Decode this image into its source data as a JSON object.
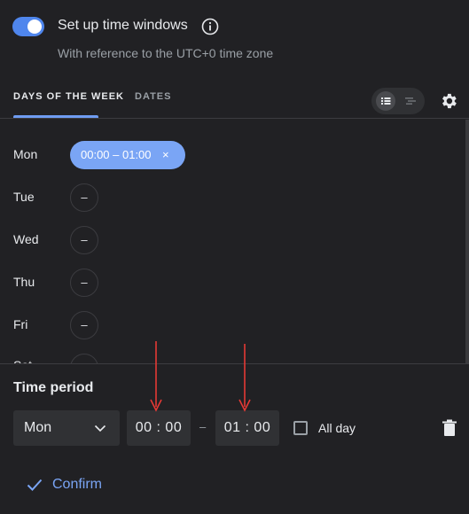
{
  "header": {
    "toggle_on": true,
    "title": "Set up time windows",
    "subtitle": "With reference to the UTC+0 time zone",
    "info_icon": "info-icon"
  },
  "tabs": [
    {
      "label": "DAYS OF THE WEEK",
      "active": true
    },
    {
      "label": "DATES",
      "active": false
    }
  ],
  "toolbar": {
    "view_list_icon": "list-view-icon",
    "view_timeline_icon": "timeline-view-icon",
    "settings_icon": "gear-icon"
  },
  "days": [
    {
      "label": "Mon",
      "range": "00:00 – 01:00",
      "remove": "×"
    },
    {
      "label": "Tue",
      "empty": "–"
    },
    {
      "label": "Wed",
      "empty": "–"
    },
    {
      "label": "Thu",
      "empty": "–"
    },
    {
      "label": "Fri",
      "empty": "–"
    },
    {
      "label": "Sat",
      "empty": "–"
    }
  ],
  "time_period": {
    "title": "Time period",
    "day": "Mon",
    "start": "00 : 00",
    "separator": "–",
    "end": "01 : 00",
    "all_day_label": "All day",
    "all_day_checked": false,
    "confirm_label": "Confirm"
  },
  "colors": {
    "accent": "#7aa5f5",
    "annotation_arrow": "#e53935",
    "background": "#212124"
  }
}
